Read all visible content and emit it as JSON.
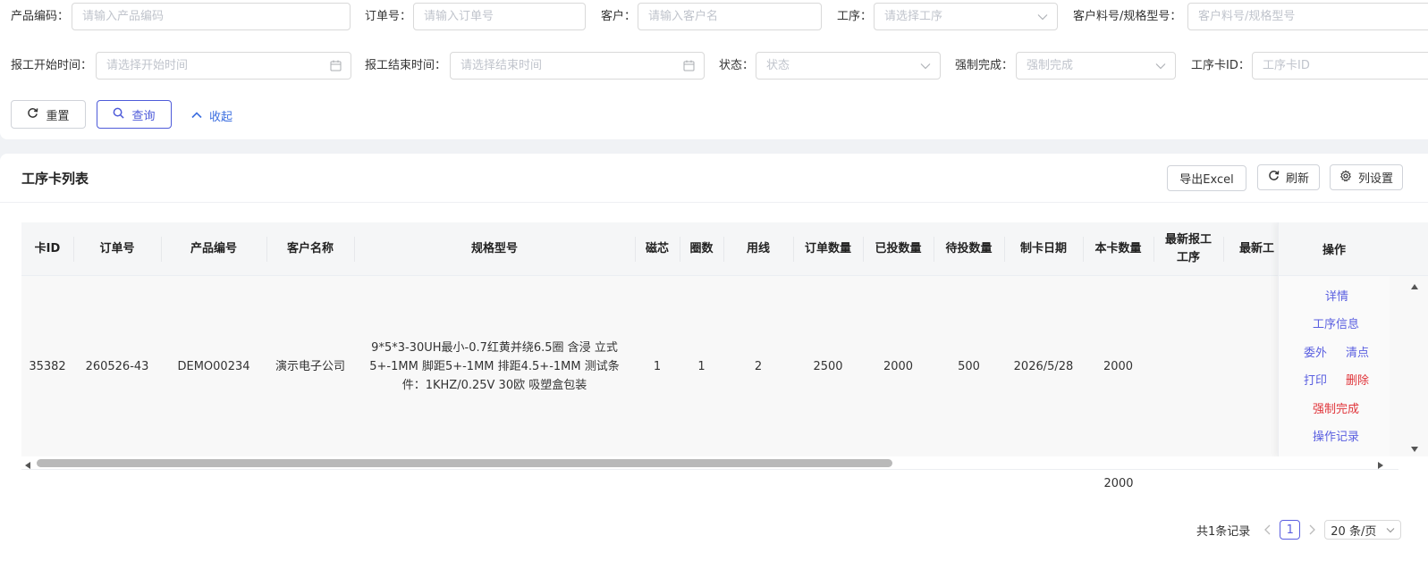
{
  "filters": {
    "product_code": {
      "label": "产品编码：",
      "placeholder": "请输入产品编码"
    },
    "order_no": {
      "label": "订单号：",
      "placeholder": "请输入订单号"
    },
    "customer": {
      "label": "客户：",
      "placeholder": "请输入客户名"
    },
    "process": {
      "label": "工序：",
      "placeholder": "请选择工序"
    },
    "customer_part": {
      "label": "客户料号/规格型号：",
      "placeholder": "客户料号/规格型号"
    },
    "report_start": {
      "label": "报工开始时间：",
      "placeholder": "请选择开始时间"
    },
    "report_end": {
      "label": "报工结束时间：",
      "placeholder": "请选择结束时间"
    },
    "status": {
      "label": "状态：",
      "placeholder": "状态"
    },
    "force_complete": {
      "label": "强制完成：",
      "placeholder": "强制完成"
    },
    "card_id": {
      "label": "工序卡ID：",
      "placeholder": "工序卡ID"
    }
  },
  "actions": {
    "reset": "重置",
    "query": "查询",
    "collapse": "收起"
  },
  "card": {
    "title": "工序卡列表",
    "export": "导出Excel",
    "refresh": "刷新",
    "columns_setting": "列设置"
  },
  "table": {
    "headers": {
      "card_id": "卡ID",
      "order_no": "订单号",
      "product_code": "产品编号",
      "customer_name": "客户名称",
      "spec": "规格型号",
      "core": "磁芯",
      "turns": "圈数",
      "wire": "用线",
      "order_qty": "订单数量",
      "fed_qty": "已投数量",
      "pending_qty": "待投数量",
      "made_date": "制卡日期",
      "card_qty": "本卡数量",
      "latest_process_a": "最新报工",
      "latest_process_b": "工序",
      "latest_worker": "最新工",
      "operation": "操作"
    },
    "rows": [
      {
        "card_id": "35382",
        "order_no": "260526-43",
        "product_code": "DEMO00234",
        "customer_name": "演示电子公司",
        "spec": "9*5*3-30UH最小-0.7红黄并绕6.5圈 含浸 立式5+-1MM 脚距5+-1MM 排距4.5+-1MM 测试条件：1KHZ/0.25V 30欧 吸塑盒包装",
        "core": "1",
        "turns": "1",
        "wire": "2",
        "order_qty": "2500",
        "fed_qty": "2000",
        "pending_qty": "500",
        "made_date": "2026/5/28",
        "card_qty": "2000"
      }
    ],
    "row_actions": {
      "detail": "详情",
      "process_info": "工序信息",
      "outsource": "委外",
      "count": "清点",
      "print": "打印",
      "delete": "删除",
      "force_complete": "强制完成",
      "op_log": "操作记录"
    },
    "summary_card_qty": "2000"
  },
  "pagination": {
    "total": "共1条记录",
    "current": "1",
    "page_size": "20 条/页"
  },
  "colors": {
    "primary": "#5a5fe0",
    "danger": "#e0343a",
    "border": "#d9d9d9"
  }
}
